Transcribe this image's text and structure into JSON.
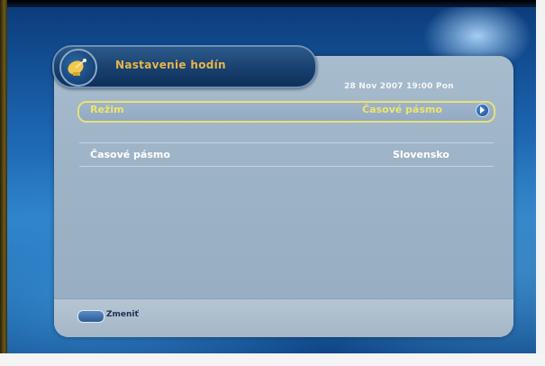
{
  "header": {
    "title": "Nastavenie hodín",
    "datetime": "28 Nov 2007 19:00 Pon"
  },
  "settings": {
    "rows": [
      {
        "label": "Režim",
        "value": "Časové pásmo"
      },
      {
        "label": "Časové pásmo",
        "value": "Slovensko"
      }
    ]
  },
  "footer": {
    "hint": "Zmeniť"
  },
  "colors": {
    "highlight": "#f0e46a",
    "title_accent": "#e6b64a"
  }
}
